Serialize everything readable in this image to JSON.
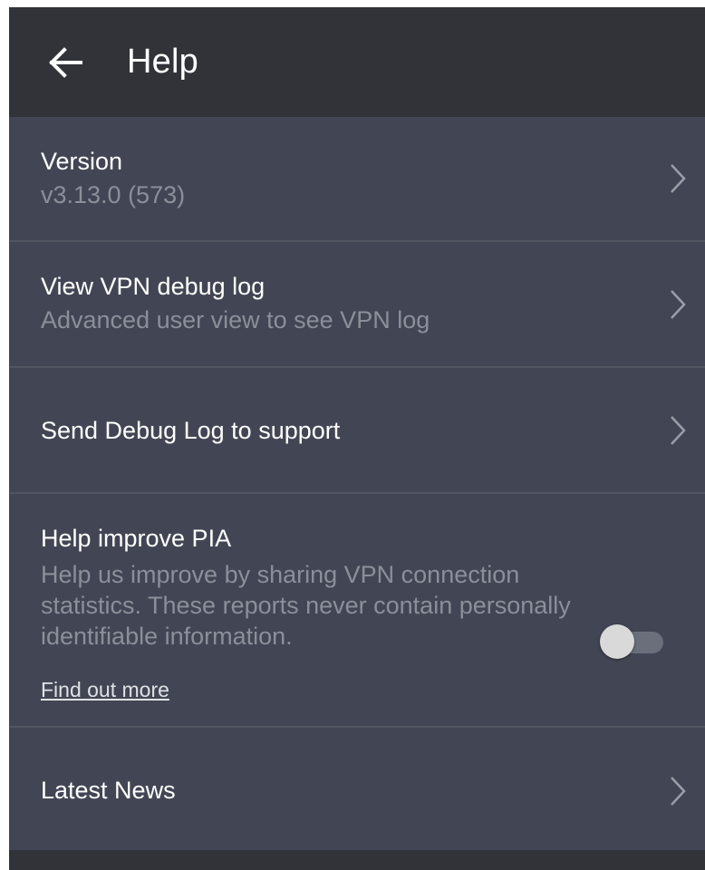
{
  "header": {
    "back_icon": "arrow-left-icon",
    "title": "Help"
  },
  "items": {
    "version": {
      "label": "Version",
      "desc": "v3.13.0 (573)",
      "icon": "chevron-right-icon"
    },
    "debug_log": {
      "label": "View VPN debug log",
      "desc": "Advanced user view to see VPN log",
      "icon": "chevron-right-icon"
    },
    "send_log": {
      "label": "Send Debug Log to support",
      "icon": "chevron-right-icon"
    },
    "improve": {
      "label": "Help improve PIA",
      "desc": "Help us improve by sharing VPN connection statistics. These reports never contain personally identifiable information.",
      "link": "Find out more",
      "toggle_on": false
    },
    "news": {
      "label": "Latest News",
      "icon": "chevron-right-icon"
    }
  },
  "colors": {
    "background": "#424654",
    "appbar": "#323339",
    "divider": "#51555f",
    "primary_text": "#ffffff",
    "secondary_text": "#8b8f99"
  }
}
